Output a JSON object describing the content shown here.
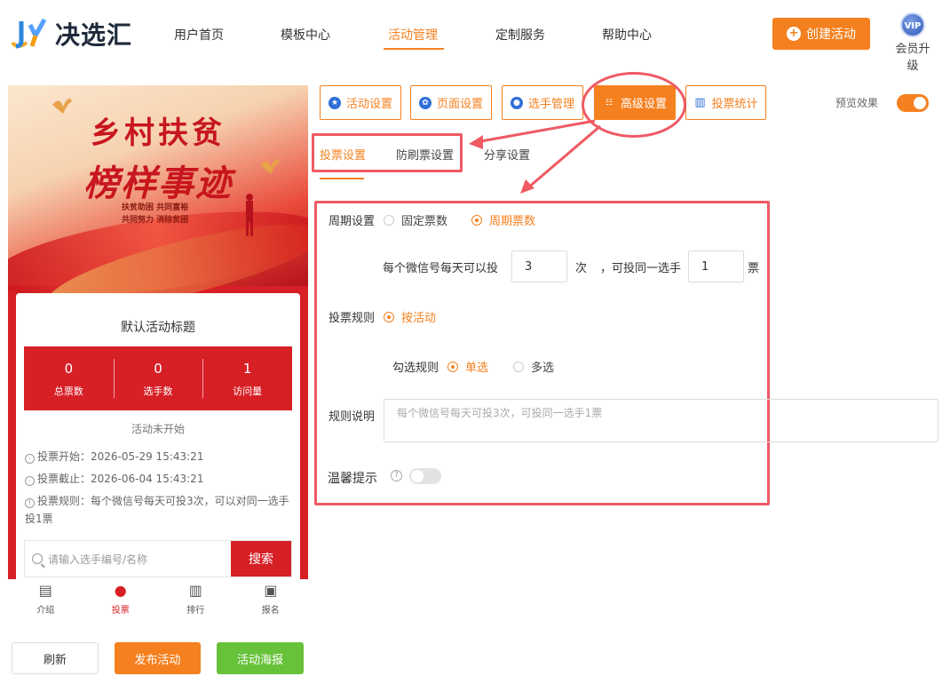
{
  "brand": {
    "name": "决选汇",
    "accent": "#f5801f",
    "red": "#d71f26"
  },
  "nav": [
    "用户首页",
    "模板中心",
    "活动管理",
    "定制服务",
    "帮助中心"
  ],
  "header": {
    "create_label": "创建活动",
    "vip_label": "会员升级",
    "vip_badge": "VIP"
  },
  "preview": {
    "banner_line1": "乡村扶贫",
    "banner_line2": "榜样事迹",
    "banner_sub1": "扶贫助困  共同富裕",
    "banner_sub2": "共同努力  消除贫困",
    "activity_title": "默认活动标题",
    "stats": [
      {
        "value": "0",
        "label": "总票数"
      },
      {
        "value": "0",
        "label": "选手数"
      },
      {
        "value": "1",
        "label": "访问量"
      }
    ],
    "status": "活动未开始",
    "vote_start": "投票开始：2026-05-29 15:43:21",
    "vote_end": "投票截止：2026-06-04 15:43:21",
    "vote_rule": "投票规则：每个微信号每天可投3次，可以对同一选手投1票",
    "search_placeholder": "请输入选手编号/名称",
    "search_btn": "搜索",
    "tabs": [
      "介绍",
      "投票",
      "排行",
      "报名"
    ]
  },
  "bottom_buttons": {
    "refresh": "刷新",
    "publish": "发布活动",
    "poster": "活动海报"
  },
  "toolbar": [
    "活动设置",
    "页面设置",
    "选手管理",
    "高级设置",
    "投票统计"
  ],
  "preview_toggle_label": "预览效果",
  "subtabs": [
    "投票设置",
    "防刷票设置",
    "分享设置"
  ],
  "form": {
    "period_label": "周期设置",
    "period_opt1": "固定票数",
    "period_opt2": "周期票数",
    "daily_prefix": "每个微信号每天可以投",
    "daily_value": "3",
    "daily_unit": "次",
    "same_prefix": "，可投同一选手",
    "same_value": "1",
    "same_unit": "票",
    "rule_label": "投票规则",
    "rule_opt": "按活动",
    "check_label": "勾选规则",
    "check_opt1": "单选",
    "check_opt2": "多选",
    "desc_label": "规则说明",
    "desc_placeholder": "每个微信号每天可投3次，可投同一选手1票",
    "tip_label": "温馨提示"
  }
}
